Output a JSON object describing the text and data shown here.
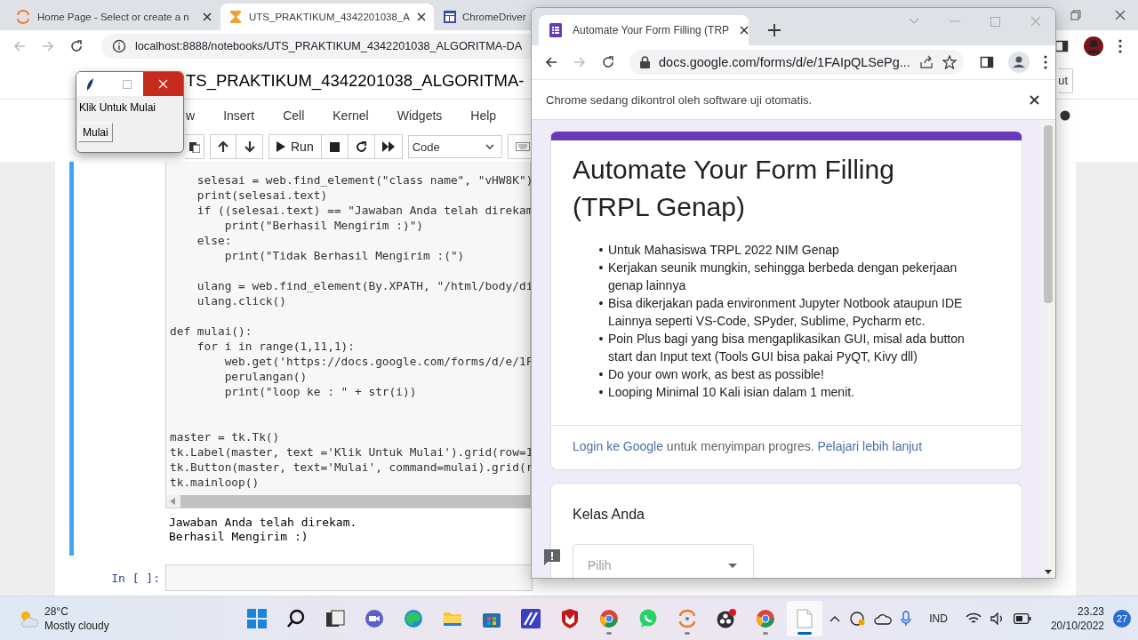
{
  "back_browser": {
    "tabs": [
      {
        "title": "Home Page - Select or create a n",
        "selected": false
      },
      {
        "title": "UTS_PRAKTIKUM_4342201038_A",
        "selected": true
      },
      {
        "title": "ChromeDriver",
        "selected": false
      }
    ],
    "url": "localhost:8888/notebooks/UTS_PRAKTIKUM_4342201038_ALGORITMA-DA",
    "notebook": {
      "title": "TS_PRAKTIKUM_4342201038_ALGORITMA-",
      "logout": "ut",
      "menu": [
        "w",
        "Insert",
        "Cell",
        "Kernel",
        "Widgets",
        "Help"
      ],
      "run": "Run",
      "cell_type": "Code",
      "code_blocks": [
        [
          "    selesai = web.find_element(\"class name\", \"vHW8K\")",
          "    print(selesai.text)",
          "    if ((selesai.text) == \"Jawaban Anda telah direkam",
          "        print(\"Berhasil Mengirim :)\")",
          "    else:",
          "        print(\"Tidak Berhasil Mengirim :(\")"
        ],
        [
          "    ulang = web.find_element(By.XPATH, \"/html/body/di",
          "    ulang.click()"
        ],
        [
          "def mulai():",
          "    for i in range(1,11,1):",
          "        web.get('https://docs.google.com/forms/d/e/1F",
          "        perulangan()",
          "        print(\"loop ke : \" + str(i))"
        ],
        [
          "master = tk.Tk()",
          "tk.Label(master, text ='Klik Untuk Mulai').grid(row=1",
          "tk.Button(master, text='Mulai', command=mulai).grid(r",
          "tk.mainloop()"
        ]
      ],
      "output": [
        "Jawaban Anda telah direkam.",
        "Berhasil Mengirim :)"
      ],
      "prompt": "In [ ]:"
    }
  },
  "tk_window": {
    "label": "Klik Untuk Mulai",
    "button": "Mulai"
  },
  "front_browser": {
    "tab": "Automate Your Form Filling (TRP",
    "url": "docs.google.com/forms/d/e/1FAIpQLSePg...",
    "infobar": "Chrome sedang dikontrol oleh software uji otomatis.",
    "form": {
      "title": "Automate Your Form Filling (TRPL Genap)",
      "bullet_marker": "•",
      "bullets": [
        "Untuk Mahasiswa TRPL 2022 NIM Genap",
        "Kerjakan seunik mungkin, sehingga berbeda dengan pekerjaan genap lainnya",
        "Bisa dikerjakan pada environment Jupyter Notbook ataupun IDE Lainnya seperti VS-Code, SPyder, Sublime, Pycharm etc.",
        "Poin Plus bagi yang bisa mengaplikasikan GUI, misal ada button start dan Input text (Tools GUI bisa pakai PyQT, Kivy dll)",
        "Do your own work, as best as possible!",
        "Looping Minimal 10 Kali isian dalam 1 menit."
      ],
      "signin": {
        "link": "Login ke Google",
        "text": "untuk menyimpan progres.",
        "more": "Pelajari lebih lanjut"
      },
      "question": {
        "title": "Kelas Anda",
        "placeholder": "Pilih"
      }
    }
  },
  "taskbar": {
    "weather": {
      "temp": "28°C",
      "condition": "Mostly cloudy"
    },
    "apps": [
      {
        "running": false,
        "selected": false
      },
      {
        "running": false,
        "selected": false
      },
      {
        "running": false,
        "selected": false
      },
      {
        "running": false,
        "selected": false
      },
      {
        "running": false,
        "selected": false
      },
      {
        "running": false,
        "selected": false
      },
      {
        "running": false,
        "selected": false
      },
      {
        "running": false,
        "selected": false
      },
      {
        "running": false,
        "selected": false
      },
      {
        "running": true,
        "selected": false
      },
      {
        "running": false,
        "selected": false
      },
      {
        "running": true,
        "selected": false
      },
      {
        "running": false,
        "selected": false
      },
      {
        "running": true,
        "selected": false
      },
      {
        "running": true,
        "selected": true
      }
    ],
    "language": "IND",
    "time": "23.23",
    "date": "20/10/2022",
    "notifications": "27"
  }
}
